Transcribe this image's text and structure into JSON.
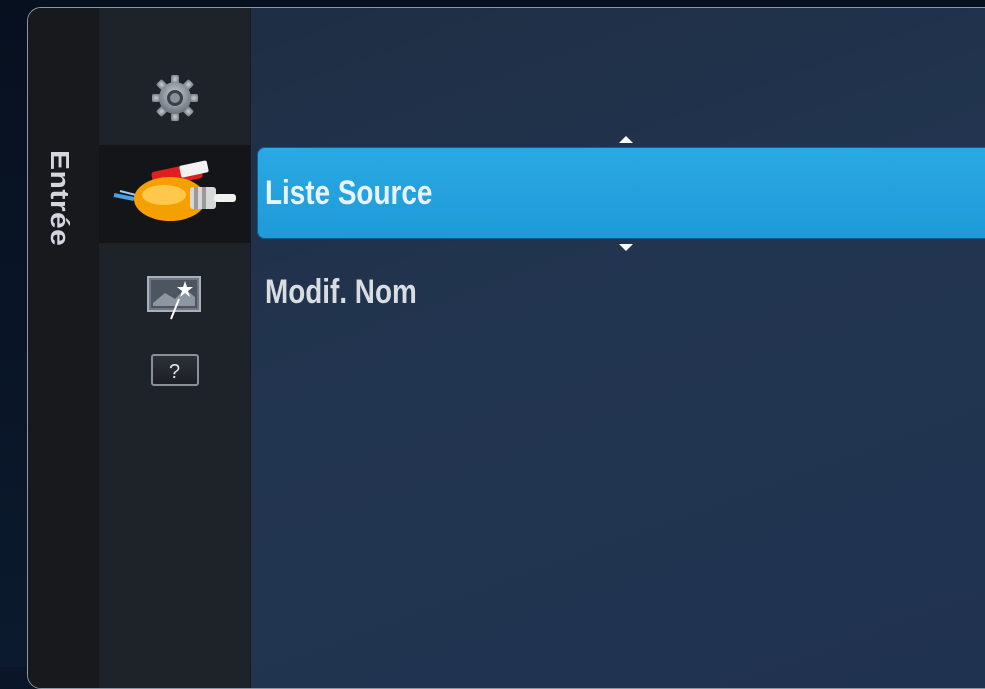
{
  "category": {
    "label": "Entrée"
  },
  "icons": [
    {
      "name": "gear-icon"
    },
    {
      "name": "av-cable-icon"
    },
    {
      "name": "picture-edit-icon"
    },
    {
      "name": "help-icon",
      "label": "?"
    }
  ],
  "menu": {
    "items": [
      {
        "label": "Liste Source",
        "selected": true
      },
      {
        "label": "Modif. Nom",
        "selected": false
      }
    ]
  },
  "colors": {
    "highlight": "#22a3df",
    "content_bg": "#203350",
    "strip_bg": "#17191d"
  }
}
